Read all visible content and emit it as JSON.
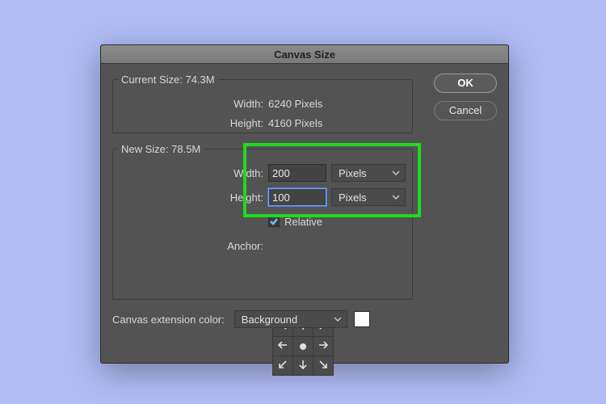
{
  "title": "Canvas Size",
  "buttons": {
    "ok": "OK",
    "cancel": "Cancel"
  },
  "current": {
    "legend": "Current Size: 74.3M",
    "width_label": "Width:",
    "width_value": "6240 Pixels",
    "height_label": "Height:",
    "height_value": "4160 Pixels"
  },
  "new": {
    "legend": "New Size: 78.5M",
    "width_label": "Width:",
    "width_value": "200",
    "width_unit": "Pixels",
    "height_label": "Height:",
    "height_value": "100",
    "height_unit": "Pixels",
    "relative_label": "Relative",
    "relative_checked": true,
    "anchor_label": "Anchor:"
  },
  "extension": {
    "label": "Canvas extension color:",
    "value": "Background",
    "swatch": "#ffffff"
  }
}
